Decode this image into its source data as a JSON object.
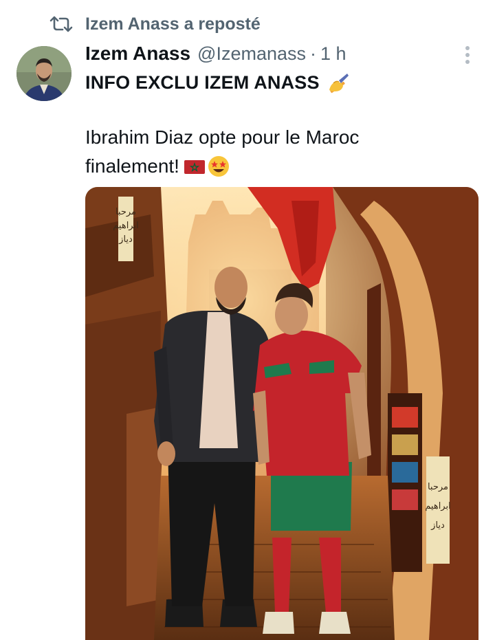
{
  "repost": {
    "label": "Izem Anass a reposté",
    "icon": "repost-icon"
  },
  "tweet": {
    "author_name": "Izem Anass",
    "handle": "@Izemanass",
    "separator": "·",
    "time": "1 h",
    "headline": "INFO EXCLU IZEM ANASS",
    "body_line1": "Ibrahim Diaz opte pour le Maroc",
    "body_line2": "finalement!",
    "emojis": [
      "writing-hand-emoji",
      "morocco-flag-emoji",
      "star-struck-emoji"
    ],
    "media": {
      "banner_top": [
        "مرحبا",
        "ابراهيم",
        "دياز"
      ],
      "banner_bottom": [
        "مرحبا",
        "ابراهيم",
        "دياز"
      ]
    }
  },
  "colors": {
    "text_primary": "#0f1419",
    "text_secondary": "#536471",
    "jersey_red": "#c4242b",
    "jersey_green": "#1f7a4d"
  }
}
